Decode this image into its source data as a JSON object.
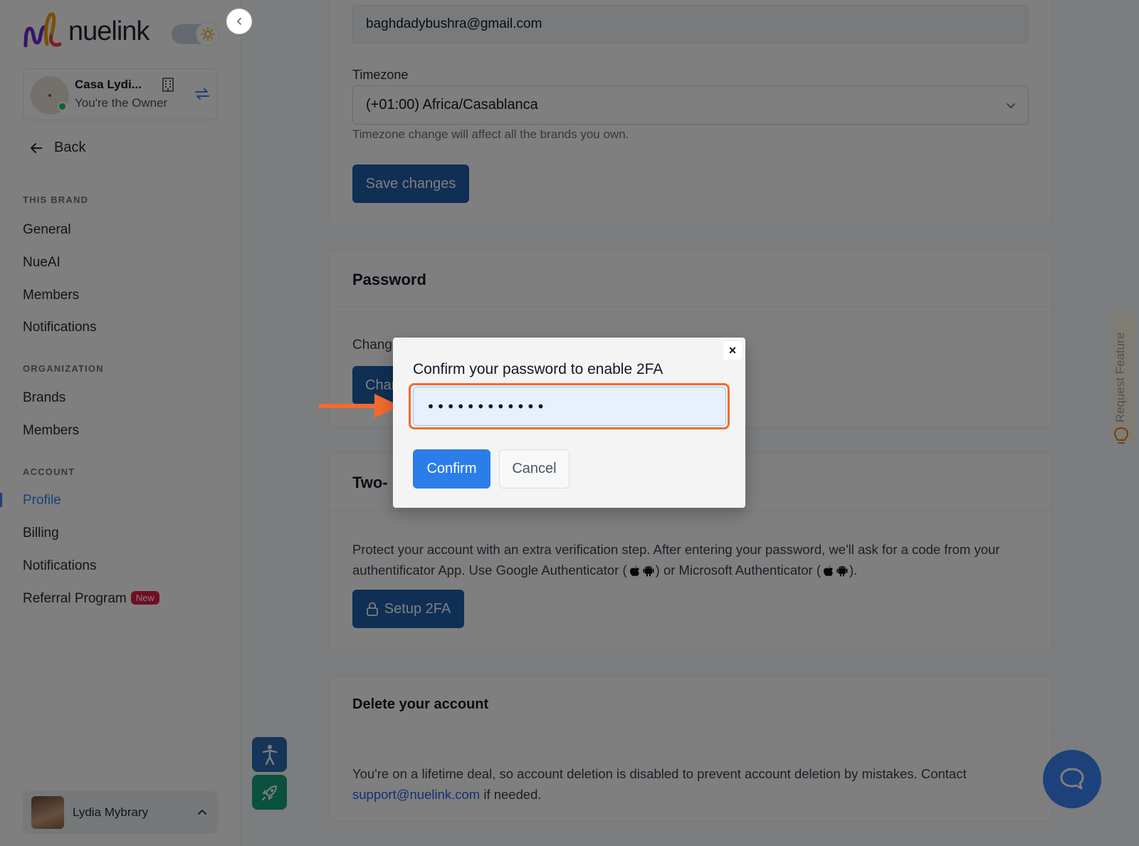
{
  "app": {
    "logo_text": "nuelink"
  },
  "brand": {
    "name": "Casa Lydi...",
    "role": "You're the Owner"
  },
  "nav": {
    "back_label": "Back",
    "sections": {
      "this_brand": "THIS BRAND",
      "organization": "ORGANIZATION",
      "account": "ACCOUNT"
    },
    "this_brand_items": [
      "General",
      "NueAI",
      "Members",
      "Notifications"
    ],
    "organization_items": [
      "Brands",
      "Members"
    ],
    "account_items": [
      "Profile",
      "Billing",
      "Notifications",
      "Referral Program"
    ],
    "active_item": "Profile",
    "new_badge": "New"
  },
  "user": {
    "name": "Lydia Mybrary"
  },
  "profile": {
    "email_value": "baghdadybushra@gmail.com",
    "timezone_label": "Timezone",
    "timezone_value": "(+01:00) Africa/Casablanca",
    "timezone_help": "Timezone change will affect all the brands you own.",
    "save_label": "Save changes"
  },
  "password_card": {
    "title": "Password",
    "text_visible": "Chang",
    "button_visible": "Char"
  },
  "twofa_card": {
    "title_visible": "Two-",
    "description_part1": "Protect your account with an extra verification step. After entering your password, we'll ask for a code from your authentificator App. Use Google Authenticator (",
    "description_part2": ") or Microsoft Authenticator (",
    "description_part3": ").",
    "setup_label": "Setup 2FA"
  },
  "delete_card": {
    "title": "Delete your account",
    "description": "You're on a lifetime deal, so account deletion is disabled to prevent account deletion by mistakes. Contact ",
    "support_email": "support@nuelink.com",
    "description_end": " if needed."
  },
  "request_feature": {
    "label": "Request Feature"
  },
  "modal": {
    "title": "Confirm your password to enable 2FA",
    "password_masked": "••••••••••••",
    "confirm_label": "Confirm",
    "cancel_label": "Cancel",
    "close_symbol": "×"
  },
  "colors": {
    "accent": "#2b7de9",
    "primary_dark": "#1e5fa8",
    "highlight_arrow": "#f46a2e",
    "badge_new": "#e11d48",
    "fab_access": "#2b6cb0",
    "fab_rocket": "#14a37f"
  },
  "icons": [
    "sun-icon",
    "chevron-left-icon",
    "building-icon",
    "switch-icon",
    "arrow-left-icon",
    "chevron-up-icon",
    "accessibility-icon",
    "rocket-icon",
    "chevron-down-icon",
    "lock-icon",
    "apple-icon",
    "android-icon",
    "lightbulb-icon",
    "chat-icon",
    "close-icon"
  ]
}
